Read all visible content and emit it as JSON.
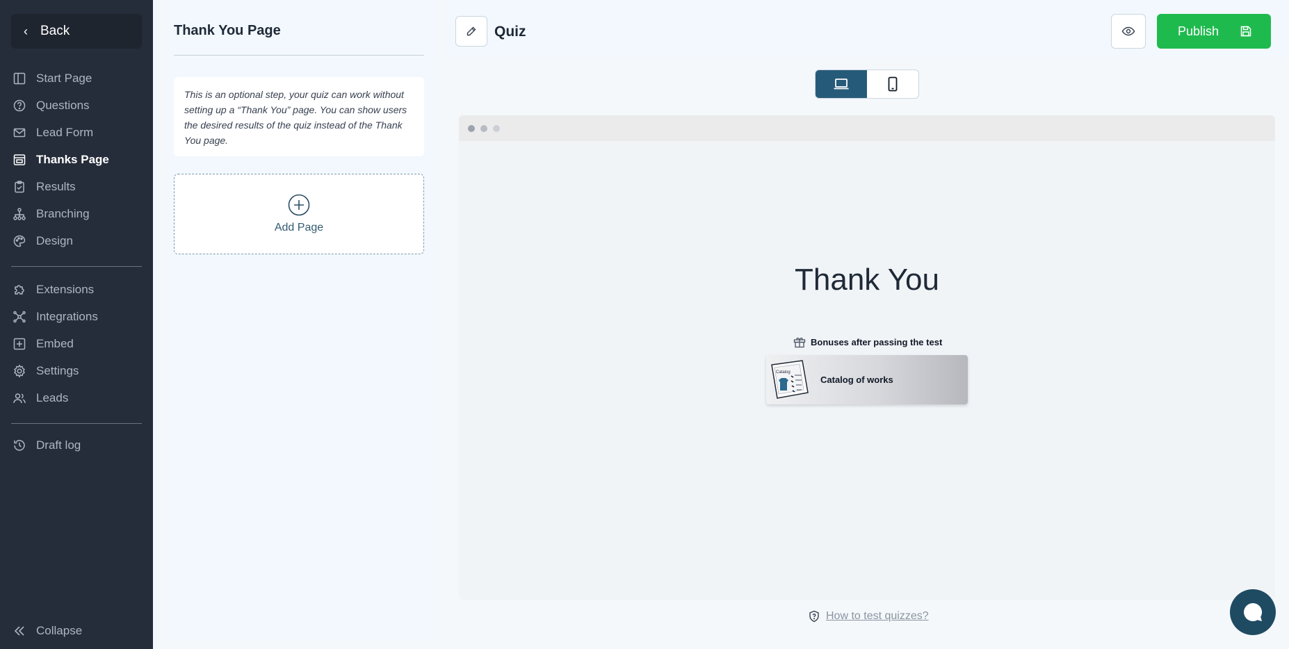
{
  "sidebar": {
    "back_label": "Back",
    "items": [
      {
        "label": "Start Page",
        "icon": "start-page-icon"
      },
      {
        "label": "Questions",
        "icon": "question-icon"
      },
      {
        "label": "Lead Form",
        "icon": "envelope-icon"
      },
      {
        "label": "Thanks Page",
        "icon": "thanks-page-icon",
        "active": true
      },
      {
        "label": "Results",
        "icon": "clipboard-icon"
      },
      {
        "label": "Branching",
        "icon": "branching-icon"
      },
      {
        "label": "Design",
        "icon": "palette-icon"
      }
    ],
    "items2": [
      {
        "label": "Extensions",
        "icon": "puzzle-icon"
      },
      {
        "label": "Integrations",
        "icon": "integrations-icon"
      },
      {
        "label": "Embed",
        "icon": "embed-icon"
      },
      {
        "label": "Settings",
        "icon": "gear-icon"
      },
      {
        "label": "Leads",
        "icon": "users-icon"
      }
    ],
    "items3": [
      {
        "label": "Draft log",
        "icon": "history-icon"
      }
    ],
    "collapse_label": "Collapse"
  },
  "panel": {
    "title": "Thank You Page",
    "info_text": "This is an optional step, your quiz can work without setting up a “Thank You” page. You can show users the desired results of the quiz instead of the Thank You page.",
    "add_page_label": "Add Page"
  },
  "header": {
    "quiz_title": "Quiz",
    "publish_label": "Publish"
  },
  "preview": {
    "title": "Thank You",
    "bonus_label": "Bonuses after passing the test",
    "catalog_label": "Catalog of works",
    "catalog_image_text": "Catalog"
  },
  "footer": {
    "howto_label": "How to test quizzes?"
  },
  "colors": {
    "sidebar_bg": "#262d3a",
    "accent": "#265a79",
    "publish": "#1fba4e"
  }
}
